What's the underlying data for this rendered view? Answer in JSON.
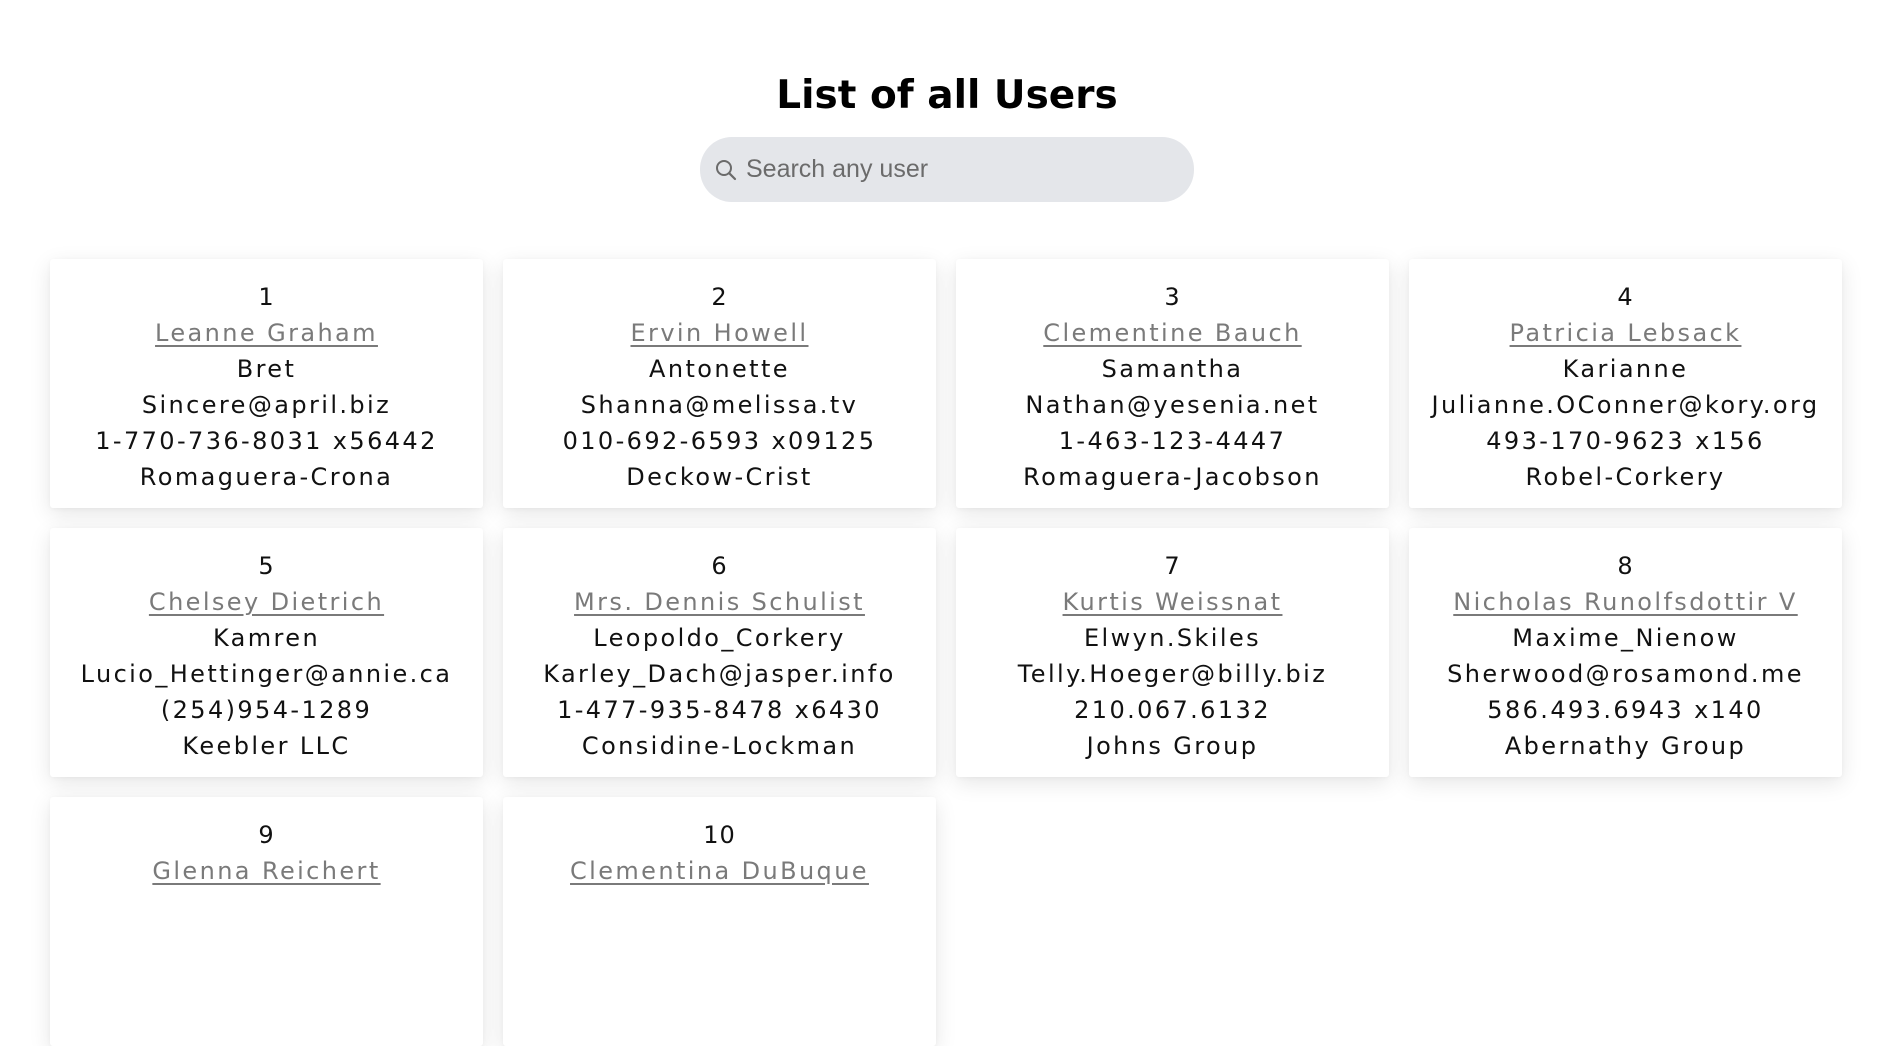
{
  "header": {
    "title": "List of all Users"
  },
  "search": {
    "placeholder": "Search any user",
    "value": ""
  },
  "users": [
    {
      "id": "1",
      "name": "Leanne Graham",
      "username": "Bret",
      "email": "Sincere@april.biz",
      "phone": "1-770-736-8031 x56442",
      "company": "Romaguera-Crona"
    },
    {
      "id": "2",
      "name": "Ervin Howell",
      "username": "Antonette",
      "email": "Shanna@melissa.tv",
      "phone": "010-692-6593 x09125",
      "company": "Deckow-Crist"
    },
    {
      "id": "3",
      "name": "Clementine Bauch",
      "username": "Samantha",
      "email": "Nathan@yesenia.net",
      "phone": "1-463-123-4447",
      "company": "Romaguera-Jacobson"
    },
    {
      "id": "4",
      "name": "Patricia Lebsack",
      "username": "Karianne",
      "email": "Julianne.OConner@kory.org",
      "phone": "493-170-9623 x156",
      "company": "Robel-Corkery"
    },
    {
      "id": "5",
      "name": "Chelsey Dietrich",
      "username": "Kamren",
      "email": "Lucio_Hettinger@annie.ca",
      "phone": "(254)954-1289",
      "company": "Keebler LLC"
    },
    {
      "id": "6",
      "name": "Mrs. Dennis Schulist",
      "username": "Leopoldo_Corkery",
      "email": "Karley_Dach@jasper.info",
      "phone": "1-477-935-8478 x6430",
      "company": "Considine-Lockman"
    },
    {
      "id": "7",
      "name": "Kurtis Weissnat",
      "username": "Elwyn.Skiles",
      "email": "Telly.Hoeger@billy.biz",
      "phone": "210.067.6132",
      "company": "Johns Group"
    },
    {
      "id": "8",
      "name": "Nicholas Runolfsdottir V",
      "username": "Maxime_Nienow",
      "email": "Sherwood@rosamond.me",
      "phone": "586.493.6943 x140",
      "company": "Abernathy Group"
    },
    {
      "id": "9",
      "name": "Glenna Reichert"
    },
    {
      "id": "10",
      "name": "Clementina DuBuque"
    }
  ],
  "icons": {
    "search": "search-icon"
  },
  "colors": {
    "search_bg": "#e4e6ea",
    "link": "#7a7a7a",
    "text": "#111111"
  }
}
